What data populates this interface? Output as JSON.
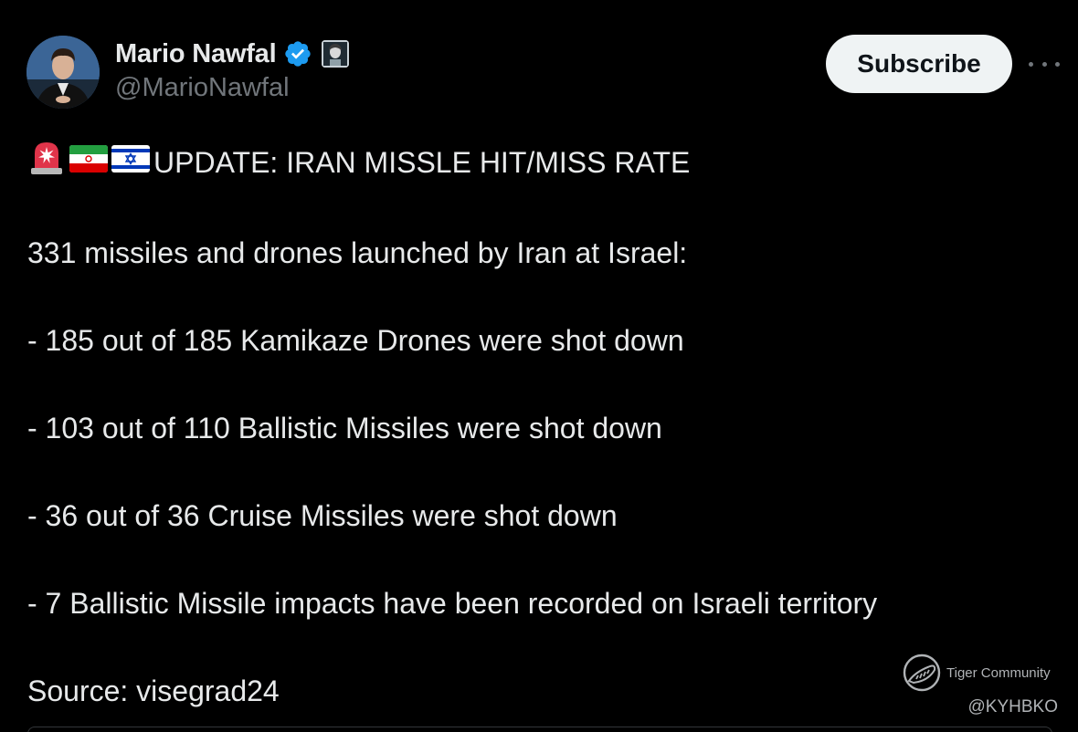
{
  "author": {
    "display_name": "Mario Nawfal",
    "handle": "@MarioNawfal",
    "verified_icon": "verified-badge-icon",
    "affiliate_icon": "affiliate-badge-icon"
  },
  "actions": {
    "subscribe_label": "Subscribe",
    "more_icon": "more-options-icon"
  },
  "tweet": {
    "headline_emojis": [
      "rotating-light-icon",
      "iran-flag-icon",
      "israel-flag-icon"
    ],
    "headline": "UPDATE: IRAN MISSLE HIT/MISS RATE",
    "intro": "331 missiles and drones launched by Iran at Israel:",
    "lines": [
      "- 185 out of 185 Kamikaze Drones were shot down",
      "- 103 out of 110 Ballistic Missiles were shot down",
      "- 36 out of 36 Cruise Missiles were shot down",
      "- 7 Ballistic Missile impacts have been recorded on Israeli territory"
    ],
    "source": "Source: visegrad24"
  },
  "watermark": {
    "logo_icon": "tiger-logo-icon",
    "community": "Tiger Community",
    "handle": "@KYHBKO"
  },
  "colors": {
    "background": "#000000",
    "text": "#e7e9ea",
    "secondary": "#71767b",
    "verified": "#1d9bf0",
    "subscribe_bg": "#eff3f4"
  }
}
